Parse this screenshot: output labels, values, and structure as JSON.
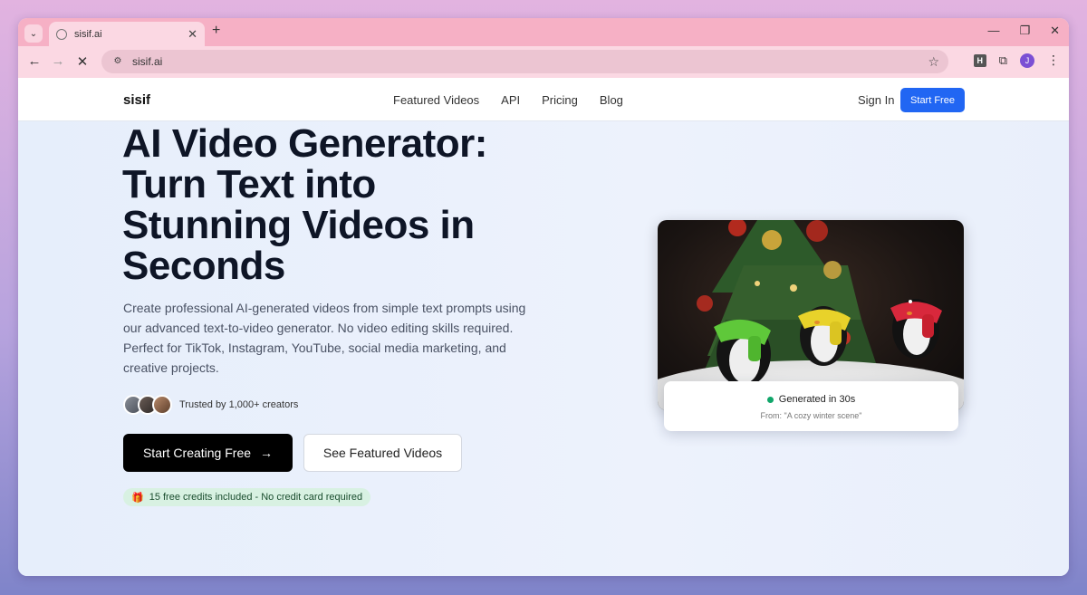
{
  "browser": {
    "tab_title": "sisif.ai",
    "url": "sisif.ai",
    "profile_initial": "J",
    "ext_label": "H"
  },
  "nav": {
    "logo": "sisif",
    "links": [
      "Featured Videos",
      "API",
      "Pricing",
      "Blog"
    ],
    "signin": "Sign In",
    "start_free": "Start Free"
  },
  "hero": {
    "title_lines": [
      "AI Video Generator:",
      "Turn Text into",
      "Stunning Videos in",
      "Seconds"
    ],
    "description": "Create professional AI-generated videos from simple text prompts using our advanced text-to-video generator. No video editing skills required. Perfect for TikTok, Instagram, YouTube, social media marketing, and creative projects.",
    "trust_text": "Trusted by 1,000+ creators",
    "primary_button": "Start Creating Free",
    "secondary_button": "See Featured Videos",
    "credits_badge": "15 free credits included - No credit card required"
  },
  "video": {
    "status": "Generated in 30s",
    "prompt_source": "From: \"A cozy winter scene\""
  },
  "colors": {
    "accent": "#2166f3",
    "status_green": "#10a66a"
  }
}
